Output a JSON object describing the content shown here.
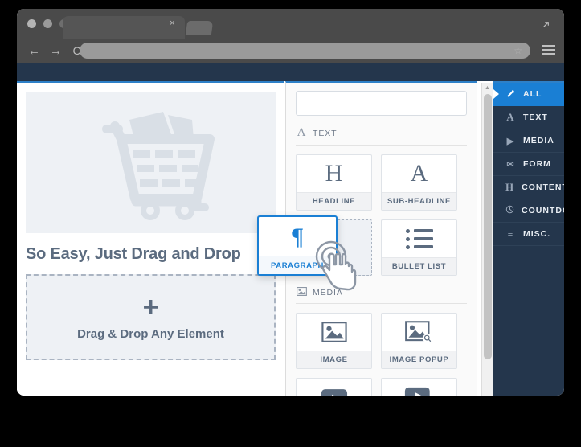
{
  "browser": {
    "tab_close_label": "×",
    "nav": {
      "back": "←",
      "forward": "→",
      "reload": "C"
    },
    "omnibox_value": "",
    "omnibox_placeholder": ""
  },
  "canvas": {
    "hero_icon": "shopping-cart-icon",
    "hero_title": "So Easy, Just Drag and Drop",
    "dropzone": {
      "plus": "+",
      "label": "Drag & Drop Any Element"
    }
  },
  "panel": {
    "search": {
      "value": "",
      "placeholder": ""
    },
    "sections": [
      {
        "icon": "text-a-icon",
        "icon_glyph": "A",
        "label": "TEXT",
        "rows": [
          [
            {
              "caption": "HEADLINE",
              "icon": "headline-h-icon",
              "glyph": "H",
              "style": "normal"
            },
            {
              "caption": "SUB-HEADLINE",
              "icon": "sub-headline-a-icon",
              "glyph": "A",
              "style": "normal"
            }
          ],
          [
            {
              "caption": "PARAGRAPH",
              "icon": "paragraph-pilcrow-icon",
              "glyph": "¶",
              "style": "ghost"
            },
            {
              "caption": "BULLET LIST",
              "icon": "bullet-list-icon",
              "glyph": "",
              "style": "normal"
            }
          ]
        ]
      },
      {
        "icon": "media-image-icon",
        "icon_glyph": "",
        "label": "MEDIA",
        "rows": [
          [
            {
              "caption": "IMAGE",
              "icon": "image-icon",
              "glyph": "",
              "style": "normal"
            },
            {
              "caption": "IMAGE POPUP",
              "icon": "image-popup-icon",
              "glyph": "",
              "style": "normal"
            }
          ],
          [
            {
              "caption": "",
              "icon": "video-icon",
              "glyph": "",
              "style": "normal"
            },
            {
              "caption": "",
              "icon": "video-popup-icon",
              "glyph": "",
              "style": "normal"
            }
          ]
        ]
      }
    ]
  },
  "drag": {
    "caption": "PARAGRAPH",
    "glyph": "¶",
    "icon": "paragraph-pilcrow-icon",
    "cursor": "hand-cursor-icon"
  },
  "sidebar": {
    "items": [
      {
        "label": "ALL",
        "icon": "magic-wand-icon",
        "glyph": "",
        "active": true
      },
      {
        "label": "TEXT",
        "icon": "text-a-icon",
        "glyph": "A",
        "active": false
      },
      {
        "label": "MEDIA",
        "icon": "play-triangle-icon",
        "glyph": "▶",
        "active": false
      },
      {
        "label": "FORM",
        "icon": "envelope-icon",
        "glyph": "✉",
        "active": false
      },
      {
        "label": "CONTENT",
        "icon": "heading-h-icon",
        "glyph": "H",
        "active": false
      },
      {
        "label": "COUNTDOWN",
        "icon": "clock-icon",
        "glyph": "◴",
        "active": false
      },
      {
        "label": "MISC.",
        "icon": "list-lines-icon",
        "glyph": "≡",
        "active": false
      }
    ]
  },
  "colors": {
    "accent_blue": "#1a7fd4",
    "navy": "#24364c",
    "chrome_gray": "#4a4a4a",
    "muted_text": "#5b6b7f",
    "placeholder_fill": "#d9dfe6"
  }
}
